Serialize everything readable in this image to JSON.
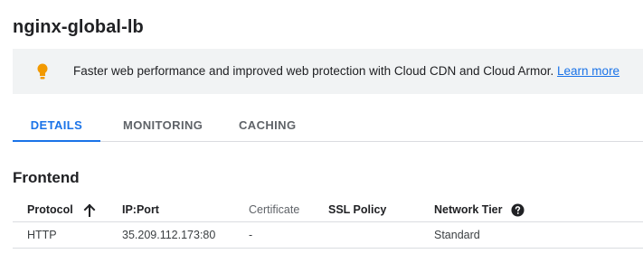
{
  "page": {
    "title": "nginx-global-lb"
  },
  "banner": {
    "icon": "lightbulb-icon",
    "icon_color": "#f29900",
    "message": "Faster web performance and improved web protection with Cloud CDN and Cloud Armor.",
    "link_label": "Learn more"
  },
  "tabs": [
    {
      "label": "DETAILS",
      "active": true
    },
    {
      "label": "MONITORING",
      "active": false
    },
    {
      "label": "CACHING",
      "active": false
    }
  ],
  "frontend": {
    "section_title": "Frontend",
    "columns": [
      "Protocol",
      "IP:Port",
      "Certificate",
      "SSL Policy",
      "Network Tier"
    ],
    "sort_icon": "arrow-up-icon",
    "help_icon": "help-icon",
    "rows": [
      [
        "HTTP",
        "35.209.112.173:80",
        "-",
        "",
        "Standard"
      ]
    ]
  },
  "colors": {
    "accent": "#1a73e8",
    "banner_bg": "#f1f3f4"
  }
}
